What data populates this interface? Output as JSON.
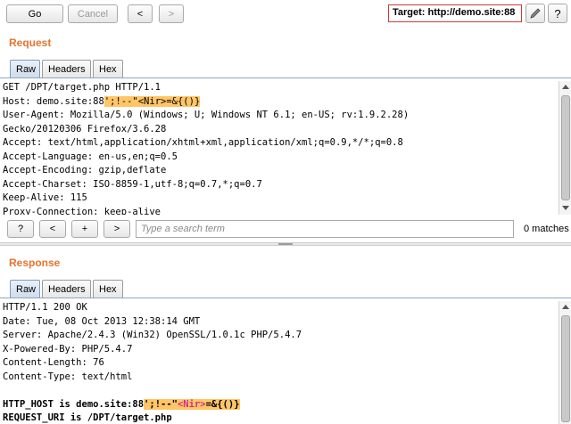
{
  "toolbar": {
    "go_label": "Go",
    "cancel_label": "Cancel",
    "back_label": "<",
    "forward_label": ">",
    "target_label": "Target: http://demo.site:88",
    "edit_icon": "pencil-icon",
    "help_label": "?"
  },
  "request": {
    "title": "Request",
    "tabs": [
      "Raw",
      "Headers",
      "Hex"
    ],
    "lines": {
      "l1": "GET /DPT/target.php HTTP/1.1",
      "host_prefix": "Host: demo.site:88",
      "host_payload_a": "';!--\"",
      "host_payload_b": "<Nir>",
      "host_payload_c": "=&{()}",
      "l3": "User-Agent: Mozilla/5.0 (Windows; U; Windows NT 6.1; en-US; rv:1.9.2.28)",
      "l4": "Gecko/20120306 Firefox/3.6.28",
      "l5": "Accept: text/html,application/xhtml+xml,application/xml;q=0.9,*/*;q=0.8",
      "l6": "Accept-Language: en-us,en;q=0.5",
      "l7": "Accept-Encoding: gzip,deflate",
      "l8": "Accept-Charset: ISO-8859-1,utf-8;q=0.7,*;q=0.7",
      "l9": "Keep-Alive: 115",
      "l10": "Proxy-Connection: keep-alive"
    }
  },
  "search": {
    "help_label": "?",
    "prev_label": "<",
    "add_label": "+",
    "next_label": ">",
    "placeholder": "Type a search term",
    "matches": "0 matches"
  },
  "response": {
    "title": "Response",
    "tabs": [
      "Raw",
      "Headers",
      "Hex"
    ],
    "lines": {
      "l1": "HTTP/1.1 200 OK",
      "l2": "Date: Tue, 08 Oct 2013 12:38:14 GMT",
      "l3": "Server: Apache/2.4.3 (Win32) OpenSSL/1.0.1c PHP/5.4.7",
      "l4": "X-Powered-By: PHP/5.4.7",
      "l5": "Content-Length: 76",
      "l6": "Content-Type: text/html",
      "host_prefix": "HTTP_HOST is demo.site:88",
      "host_payload_a": "';!--\"",
      "host_payload_b": "<Nir>",
      "host_payload_c": "=&{()}",
      "uri": "REQUEST_URI is /DPT/target.php"
    }
  }
}
